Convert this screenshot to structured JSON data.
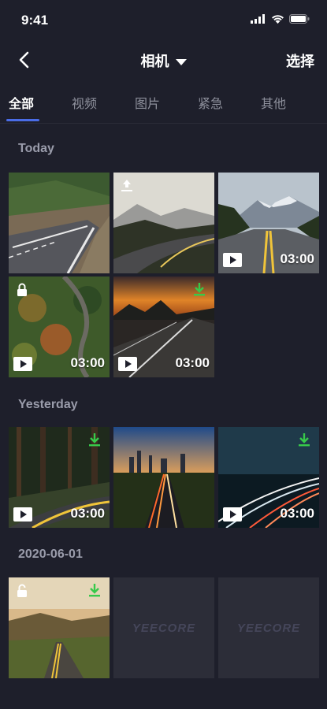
{
  "status_bar": {
    "time": "9:41"
  },
  "nav": {
    "title": "相机",
    "select_label": "选择"
  },
  "tabs": [
    {
      "label": "全部",
      "active": true
    },
    {
      "label": "视频",
      "active": false
    },
    {
      "label": "图片",
      "active": false
    },
    {
      "label": "紧急",
      "active": false
    },
    {
      "label": "其他",
      "active": false
    }
  ],
  "sections": [
    {
      "label": "Today",
      "items": [
        {
          "type": "photo",
          "scene": "coastal-road"
        },
        {
          "type": "photo",
          "scene": "mountain-curve",
          "icon": "upload-icon"
        },
        {
          "type": "video",
          "scene": "mountain-highway",
          "duration": "03:00"
        },
        {
          "type": "video",
          "scene": "forest-aerial",
          "duration": "03:00",
          "icon": "lock-icon"
        },
        {
          "type": "video",
          "scene": "sunset-highway",
          "duration": "03:00",
          "icon": "download-icon"
        }
      ]
    },
    {
      "label": "Yesterday",
      "items": [
        {
          "type": "video",
          "scene": "forest-road",
          "duration": "03:00",
          "icon": "download-icon"
        },
        {
          "type": "photo",
          "scene": "city-lights"
        },
        {
          "type": "video",
          "scene": "night-light-trails",
          "duration": "03:00",
          "icon": "download-icon"
        }
      ]
    },
    {
      "label": "2020-06-01",
      "items": [
        {
          "type": "photo",
          "scene": "hill-road",
          "icons": [
            "unlock-icon",
            "download-icon"
          ]
        },
        {
          "type": "placeholder",
          "logo": "YEECORE"
        },
        {
          "type": "placeholder",
          "logo": "YEECORE"
        }
      ]
    }
  ],
  "colors": {
    "background": "#1e1f2b",
    "accent": "#4a6ce6",
    "download_green": "#37c94a",
    "muted_text": "#9a9cab"
  }
}
